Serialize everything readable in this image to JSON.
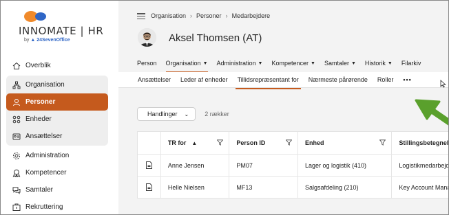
{
  "app": {
    "logo_text": "INNOMATE | HR",
    "logo_by": "by",
    "logo_brand": "24SevenOffice"
  },
  "sidebar": {
    "items": [
      {
        "label": "Overblik",
        "icon": "home-icon"
      },
      {
        "label": "Organisation",
        "icon": "org-chart-icon"
      },
      {
        "label": "Personer",
        "icon": "person-icon",
        "active": true
      },
      {
        "label": "Enheder",
        "icon": "units-icon"
      },
      {
        "label": "Ansættelser",
        "icon": "employment-icon"
      },
      {
        "label": "Administration",
        "icon": "settings-icon"
      },
      {
        "label": "Kompetencer",
        "icon": "skills-icon"
      },
      {
        "label": "Samtaler",
        "icon": "chat-icon"
      },
      {
        "label": "Rekruttering",
        "icon": "recruit-icon"
      }
    ]
  },
  "header": {
    "breadcrumbs": [
      "Organisation",
      "Personer",
      "Medarbejdere"
    ],
    "person_name": "Aksel Thomsen (AT)",
    "tabs": [
      {
        "label": "Person",
        "dropdown": false
      },
      {
        "label": "Organisation",
        "dropdown": true,
        "active": true
      },
      {
        "label": "Administration",
        "dropdown": true
      },
      {
        "label": "Kompetencer",
        "dropdown": true
      },
      {
        "label": "Samtaler",
        "dropdown": true
      },
      {
        "label": "Historik",
        "dropdown": true
      },
      {
        "label": "Filarkiv",
        "dropdown": false
      }
    ],
    "subtabs": [
      {
        "label": "Ansættelser"
      },
      {
        "label": "Leder af enheder"
      },
      {
        "label": "Tillidsrepræsentant for",
        "active": true
      },
      {
        "label": "Nærmeste pårørende"
      },
      {
        "label": "Roller"
      }
    ],
    "more": "•••"
  },
  "toolbar": {
    "actions_label": "Handlinger",
    "count_text": "2 rækker"
  },
  "table": {
    "columns": [
      "TR for",
      "Person ID",
      "Enhed",
      "Stillingsbetegnelse"
    ],
    "rows": [
      [
        "Anne Jensen",
        "PM07",
        "Lager og logistik (410)",
        "Logistikmedarbejder"
      ],
      [
        "Helle Nielsen",
        "MF13",
        "Salgsafdeling (210)",
        "Key Account Manager"
      ]
    ]
  },
  "colors": {
    "accent": "#c55a1d",
    "arrow": "#5aa02c",
    "brand_blue": "#2f66c6",
    "brand_orange": "#f08a2b"
  }
}
